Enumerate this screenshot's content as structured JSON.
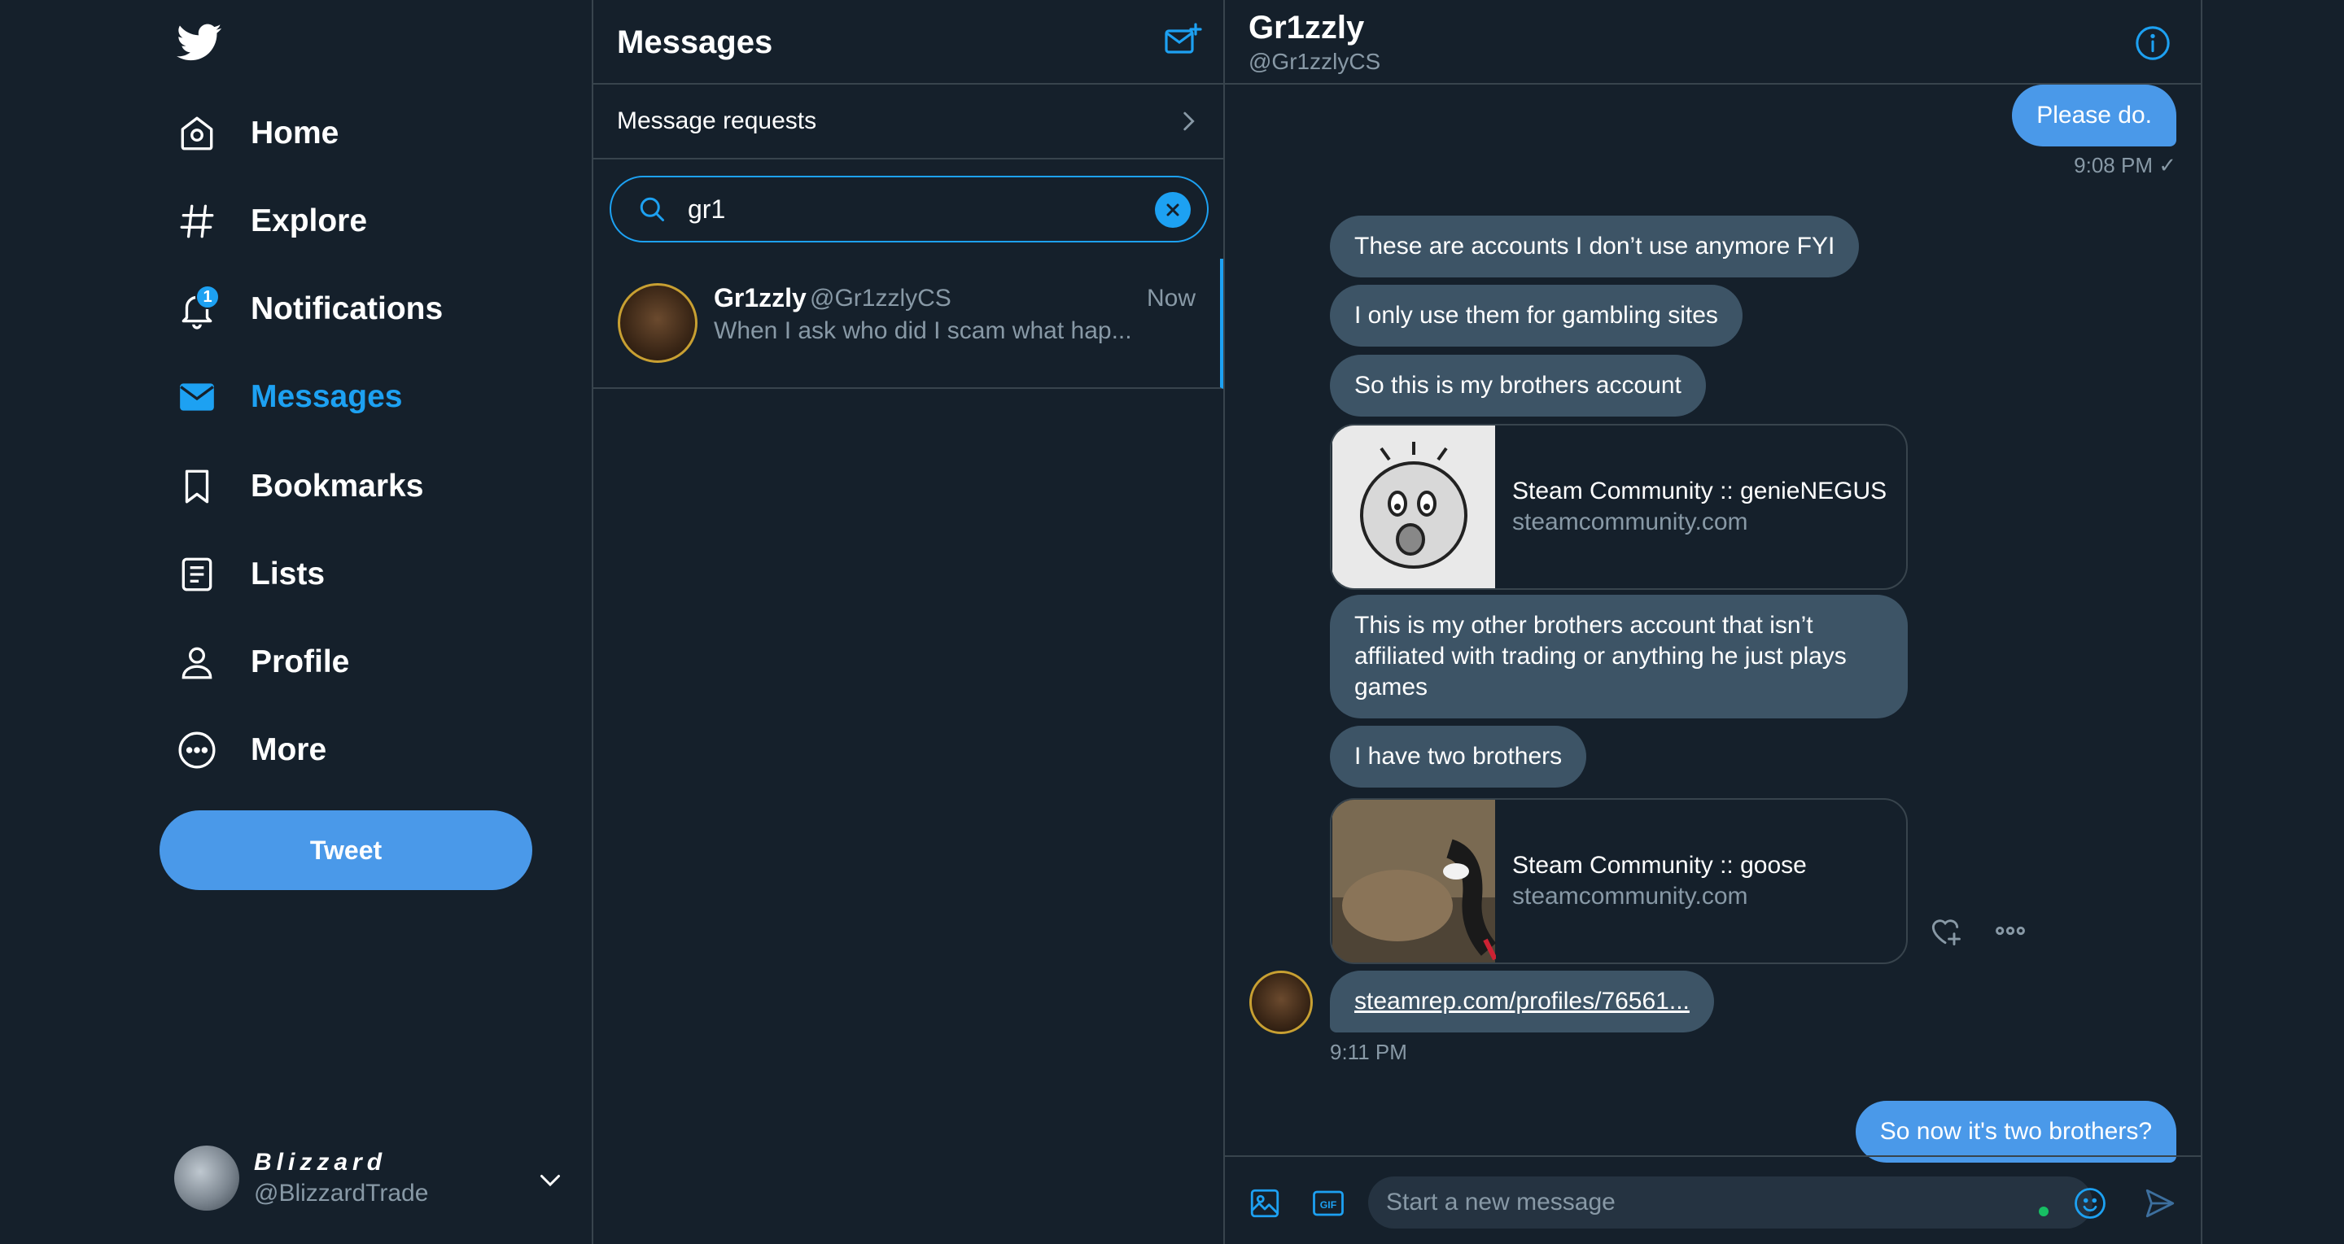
{
  "sidebar": {
    "nav": [
      {
        "label": "Home",
        "icon": "home-icon"
      },
      {
        "label": "Explore",
        "icon": "hashtag-icon"
      },
      {
        "label": "Notifications",
        "icon": "bell-icon",
        "badge": "1"
      },
      {
        "label": "Messages",
        "icon": "envelope-icon",
        "active": true
      },
      {
        "label": "Bookmarks",
        "icon": "bookmark-icon"
      },
      {
        "label": "Lists",
        "icon": "list-icon"
      },
      {
        "label": "Profile",
        "icon": "person-icon"
      },
      {
        "label": "More",
        "icon": "more-circle-icon"
      }
    ],
    "tweet_label": "Tweet",
    "account": {
      "name": "Blizzard",
      "handle": "@BlizzardTrade"
    }
  },
  "messages_list": {
    "title": "Messages",
    "requests_label": "Message requests",
    "search_value": "gr1",
    "conversations": [
      {
        "name": "Gr1zzly",
        "handle": "@Gr1zzlyCS",
        "time": "Now",
        "snippet": "When I ask who did I scam what hap..."
      }
    ]
  },
  "chat": {
    "name": "Gr1zzly",
    "handle": "@Gr1zzlyCS",
    "messages": {
      "out1": "Please do.",
      "out1_time": "9:08 PM ✓",
      "in1": "These are accounts I don’t use anymore FYI",
      "in2": "I only use them for gambling sites",
      "in3": "So this is my brothers account",
      "card1_title": "Steam Community :: genieNEGUS",
      "card1_domain": "steamcommunity.com",
      "in4": "This is my other brothers account that isn’t affiliated with trading or anything he just plays games",
      "in5": "I have two brothers",
      "card2_title": "Steam Community :: goose",
      "card2_domain": "steamcommunity.com",
      "in6": "steamrep.com/profiles/76561...",
      "in_time": "9:11 PM",
      "out2": "So now it's two brothers?"
    },
    "composer_placeholder": "Start a new message"
  },
  "colors": {
    "accent": "#1da1f2",
    "background": "#15202b",
    "incoming_bubble": "#3d5466",
    "outgoing_bubble": "#4a99e9",
    "border": "#38444d",
    "muted": "#8899a6"
  }
}
